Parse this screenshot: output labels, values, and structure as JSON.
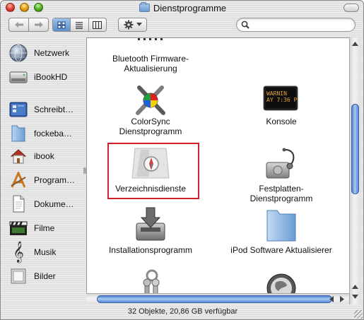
{
  "window": {
    "title": "Dienstprogramme"
  },
  "toolbar": {
    "back_icon": "back-arrow-icon",
    "forward_icon": "forward-arrow-icon",
    "views": [
      "icon-view-icon",
      "list-view-icon",
      "column-view-icon"
    ],
    "active_view": "icon-view",
    "action_icon": "gear-icon",
    "search": {
      "value": "",
      "placeholder": ""
    }
  },
  "sidebar": {
    "items": [
      {
        "label": "Netzwerk",
        "icon": "network-globe-icon"
      },
      {
        "label": "iBookHD",
        "icon": "hard-drive-icon"
      },
      {
        "label": "Schreibt…",
        "icon": "desktop-icon"
      },
      {
        "label": "fockeba…",
        "icon": "folder-icon"
      },
      {
        "label": "ibook",
        "icon": "home-icon"
      },
      {
        "label": "Program…",
        "icon": "applications-icon"
      },
      {
        "label": "Dokume…",
        "icon": "documents-icon"
      },
      {
        "label": "Filme",
        "icon": "movies-icon"
      },
      {
        "label": "Musik",
        "icon": "music-icon"
      },
      {
        "label": "Bilder",
        "icon": "pictures-icon"
      }
    ]
  },
  "content": {
    "items": [
      {
        "label_line1": "Bluetooth Firmware-",
        "label_line2": "Aktualisierung",
        "icon": "bluetooth-firmware-icon"
      },
      {
        "label_line1": "ColorSync",
        "label_line2": "Dienstprogramm",
        "icon": "colorsync-icon"
      },
      {
        "label_line1": "Konsole",
        "label_line2": "",
        "icon": "console-icon",
        "screen_text_1": "WARNIN",
        "screen_text_2": "AY 7:36 P"
      },
      {
        "label_line1": "Verzeichnisdienste",
        "label_line2": "",
        "icon": "directory-services-icon",
        "highlighted": true
      },
      {
        "label_line1": "Festplatten-",
        "label_line2": "Dienstprogramm",
        "icon": "disk-utility-icon"
      },
      {
        "label_line1": "Installationsprogramm",
        "label_line2": "",
        "icon": "installer-icon"
      },
      {
        "label_line1": "iPod Software Aktualisierer",
        "label_line2": "",
        "icon": "ipod-updater-folder-icon"
      },
      {
        "label_line1": "",
        "label_line2": "",
        "icon": "keychain-icon"
      },
      {
        "label_line1": "",
        "label_line2": "",
        "icon": "network-utility-icon"
      }
    ],
    "highlight_color": "#d0202a"
  },
  "status_bar": {
    "text": "32 Objekte, 20,86 GB verfügbar"
  },
  "colors": {
    "selection_blue": "#5d8fcb",
    "scroll_blue": "#4d7fd0"
  }
}
